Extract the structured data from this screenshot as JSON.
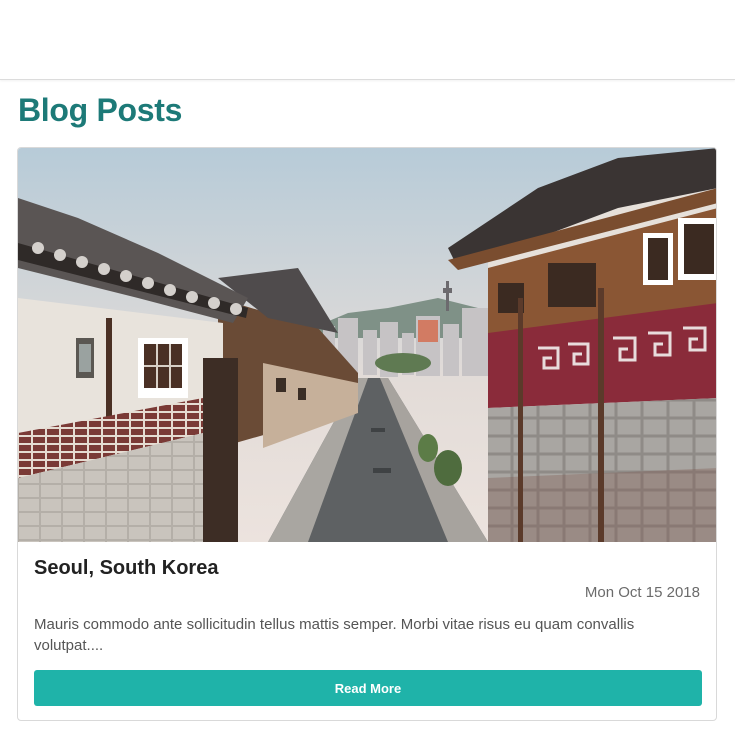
{
  "header": {},
  "page": {
    "title": "Blog Posts"
  },
  "posts": [
    {
      "image_alt": "Narrow street lined with traditional Korean hanok houses leading toward the Seoul skyline",
      "title": "Seoul, South Korea",
      "date": "Mon Oct 15 2018",
      "excerpt": "Mauris commodo ante sollicitudin tellus mattis semper. Morbi vitae risus eu quam convallis volutpat....",
      "read_more_label": "Read More"
    }
  ],
  "colors": {
    "title": "#1d7a78",
    "button": "#1fb3a9"
  }
}
